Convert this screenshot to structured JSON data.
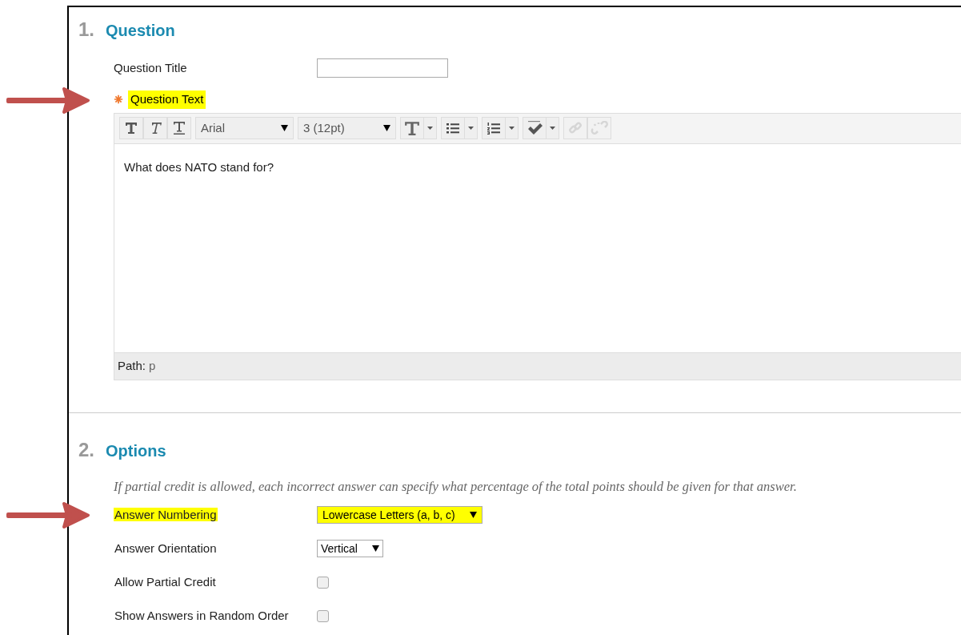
{
  "sections": [
    {
      "number": "1.",
      "title": "Question",
      "kind": "question"
    },
    {
      "number": "2.",
      "title": "Options",
      "kind": "options"
    }
  ],
  "question_title": {
    "label": "Question Title"
  },
  "question_text": {
    "label": "Question Text",
    "required": true,
    "highlighted": true,
    "annotated": true,
    "toolbar": [
      {
        "kind": "bold",
        "disabled": false
      },
      {
        "kind": "italic",
        "disabled": false
      },
      {
        "kind": "underline",
        "disabled": false
      },
      {
        "kind": "select",
        "value": "Arial",
        "disabled": false
      },
      {
        "kind": "select",
        "value": "3 (12pt)",
        "disabled": false
      },
      {
        "kind": "text-color",
        "disabled": false
      },
      {
        "kind": "bullet-list",
        "disabled": false
      },
      {
        "kind": "numbered-list",
        "disabled": false
      },
      {
        "kind": "spellcheck",
        "disabled": false
      },
      {
        "kind": "link",
        "disabled": true
      },
      {
        "kind": "unlink",
        "disabled": true
      }
    ],
    "content": "What does NATO stand for?",
    "path_label": "Path:",
    "path_value": "p"
  },
  "options": {
    "note": "If partial credit is allowed, each incorrect answer can specify what percentage of the total points should be given for that answer.",
    "rows": [
      {
        "kind": "select",
        "label": "Answer Numbering",
        "value": "Lowercase Letters (a, b, c)",
        "highlighted": true,
        "annotated": true
      },
      {
        "kind": "select",
        "label": "Answer Orientation",
        "value": "Vertical",
        "highlighted": false,
        "annotated": false
      },
      {
        "kind": "checkbox",
        "label": "Allow Partial Credit",
        "checked": false,
        "highlighted": false,
        "annotated": false
      },
      {
        "kind": "checkbox",
        "label": "Show Answers in Random Order",
        "checked": false,
        "highlighted": false,
        "annotated": false
      }
    ]
  }
}
